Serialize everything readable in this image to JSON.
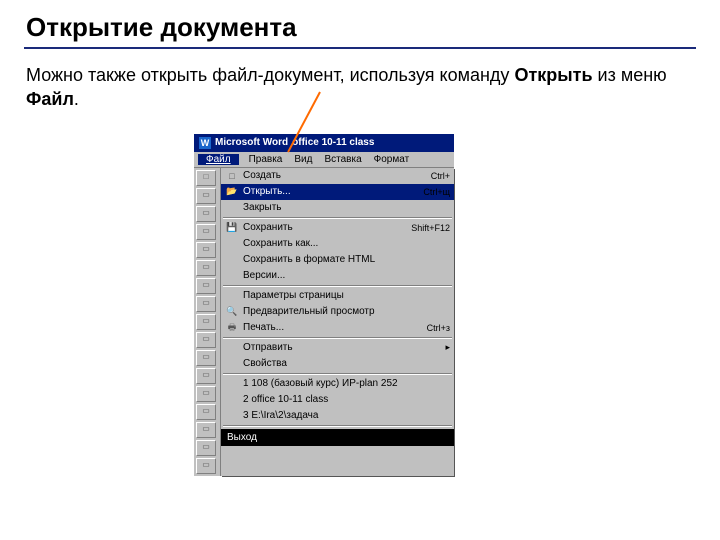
{
  "slide": {
    "title": "Открытие документа",
    "paragraph_pre": "Можно также открыть файл-документ, используя команду ",
    "bold1": "Открыть",
    "mid": " из меню ",
    "bold2": "Файл",
    "suffix": "."
  },
  "screenshot": {
    "app_name": "Microsoft Word",
    "doc_name": "office 10-11 class",
    "menubar": [
      "Файл",
      "Правка",
      "Вид",
      "Вставка",
      "Формат"
    ],
    "menu": [
      {
        "icon": "□",
        "label": "Создать",
        "shortcut": "Ctrl+"
      },
      {
        "icon": "📂",
        "label": "Открыть...",
        "shortcut": "Ctrl+щ",
        "highlight": true
      },
      {
        "icon": "",
        "label": "Закрыть",
        "shortcut": ""
      },
      {
        "sep": true
      },
      {
        "icon": "💾",
        "label": "Сохранить",
        "shortcut": "Shift+F12"
      },
      {
        "icon": "",
        "label": "Сохранить как...",
        "shortcut": ""
      },
      {
        "icon": "",
        "label": "Сохранить в формате HTML",
        "shortcut": ""
      },
      {
        "icon": "",
        "label": "Версии...",
        "shortcut": ""
      },
      {
        "sep": true
      },
      {
        "icon": "",
        "label": "Параметры страницы",
        "shortcut": ""
      },
      {
        "icon": "🔍",
        "label": "Предварительный просмотр",
        "shortcut": ""
      },
      {
        "icon": "🖶",
        "label": "Печать...",
        "shortcut": "Ctrl+з"
      },
      {
        "sep": true
      },
      {
        "icon": "",
        "label": "Отправить",
        "shortcut": "▸"
      },
      {
        "icon": "",
        "label": "Свойства",
        "shortcut": ""
      },
      {
        "sep": true
      },
      {
        "icon": "",
        "label": "1 108 (базовый курс) ИР-plan 252",
        "shortcut": ""
      },
      {
        "icon": "",
        "label": "2 office 10-11 class",
        "shortcut": ""
      },
      {
        "icon": "",
        "label": "3 E:\\Ira\\2\\задача",
        "shortcut": ""
      },
      {
        "sep": true
      }
    ],
    "exit": "Выход"
  }
}
